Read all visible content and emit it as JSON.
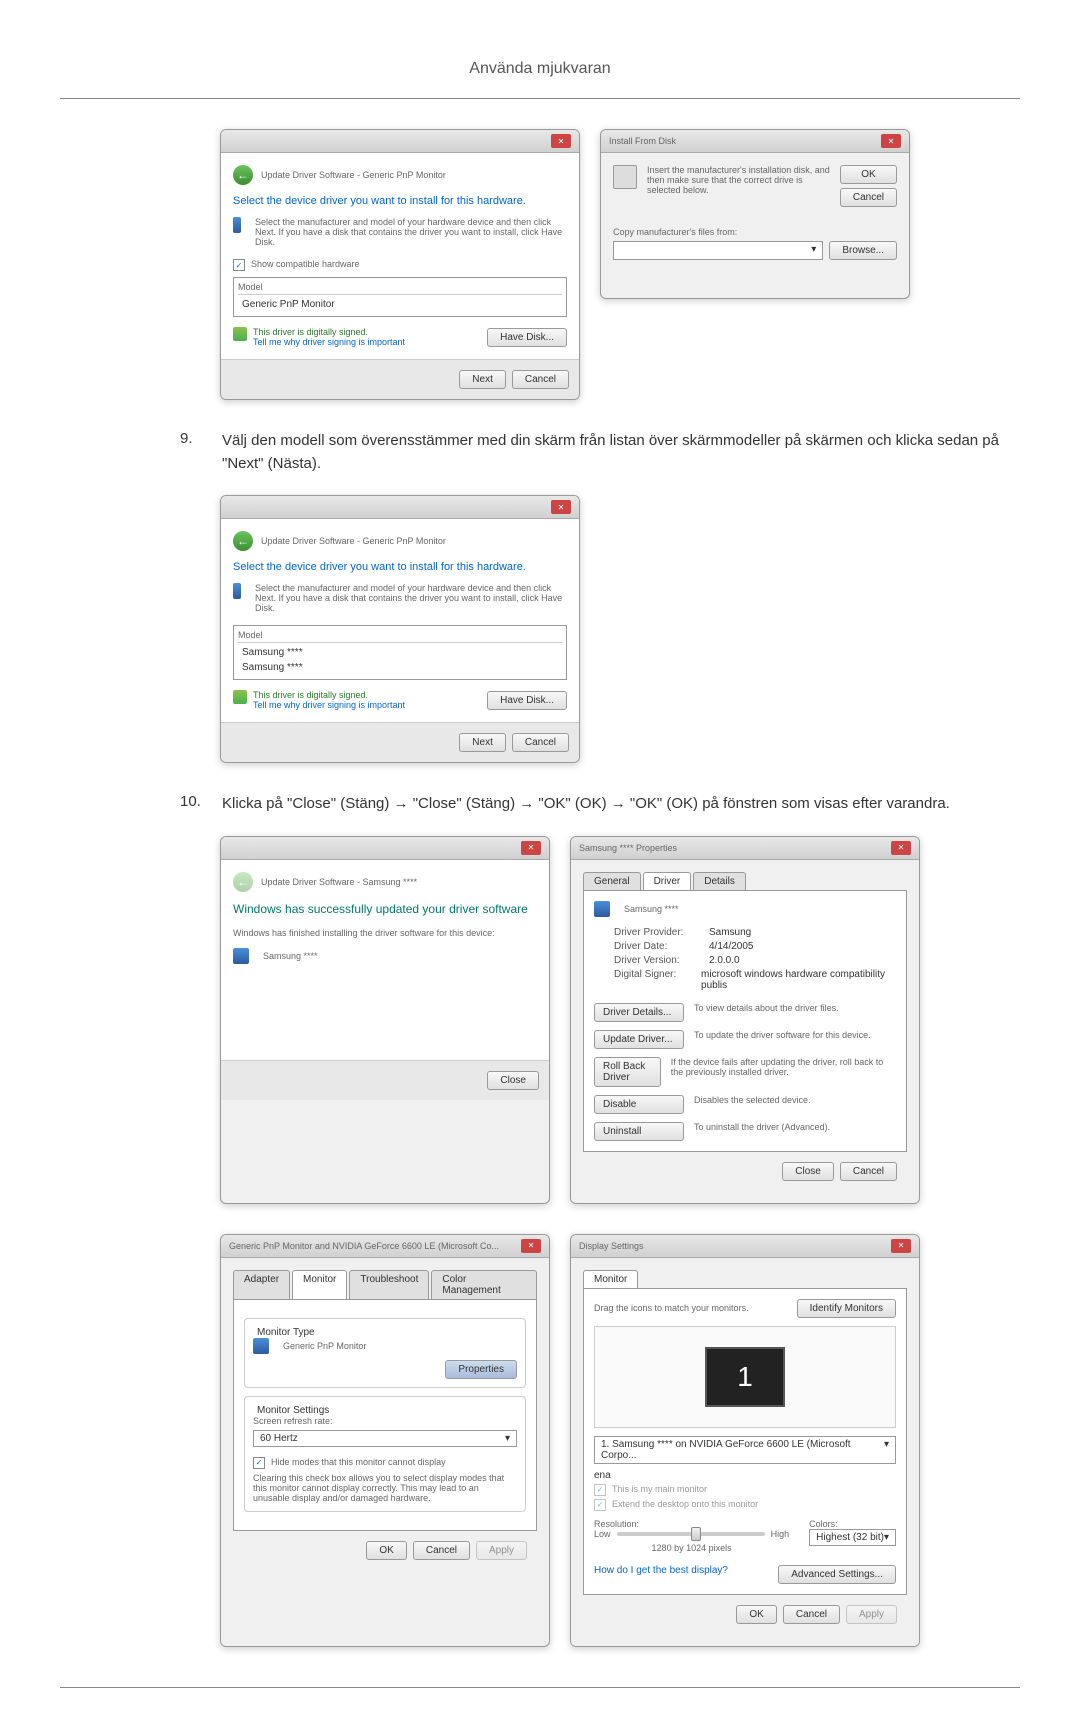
{
  "header": {
    "title": "Använda mjukvaran"
  },
  "windows": {
    "updateDriver1": {
      "breadcrumb": "Update Driver Software - Generic PnP Monitor",
      "heading": "Select the device driver you want to install for this hardware.",
      "description": "Select the manufacturer and model of your hardware device and then click Next. If you have a disk that contains the driver you want to install, click Have Disk.",
      "showCompatible": "Show compatible hardware",
      "modelLabel": "Model",
      "models": [
        "Generic PnP Monitor"
      ],
      "signedText": "This driver is digitally signed.",
      "signedLink": "Tell me why driver signing is important",
      "haveDisk": "Have Disk...",
      "next": "Next",
      "cancel": "Cancel"
    },
    "installFromDisk": {
      "title": "Install From Disk",
      "instruction": "Insert the manufacturer's installation disk, and then make sure that the correct drive is selected below.",
      "ok": "OK",
      "cancel": "Cancel",
      "copyFrom": "Copy manufacturer's files from:",
      "browse": "Browse..."
    },
    "updateDriver2": {
      "breadcrumb": "Update Driver Software - Generic PnP Monitor",
      "heading": "Select the device driver you want to install for this hardware.",
      "description": "Select the manufacturer and model of your hardware device and then click Next. If you have a disk that contains the driver you want to install, click Have Disk.",
      "modelLabel": "Model",
      "models": [
        "Samsung ****",
        "Samsung ****"
      ],
      "signedText": "This driver is digitally signed.",
      "signedLink": "Tell me why driver signing is important",
      "haveDisk": "Have Disk...",
      "next": "Next",
      "cancel": "Cancel"
    },
    "updateSuccess": {
      "breadcrumb": "Update Driver Software - Samsung ****",
      "heading": "Windows has successfully updated your driver software",
      "subtext": "Windows has finished installing the driver software for this device:",
      "deviceName": "Samsung ****",
      "close": "Close"
    },
    "properties": {
      "title": "Samsung **** Properties",
      "tabs": [
        "General",
        "Driver",
        "Details"
      ],
      "deviceName": "Samsung ****",
      "driverProvider": "Samsung",
      "driverDate": "4/14/2005",
      "driverVersion": "2.0.0.0",
      "digitalSigner": "microsoft windows hardware compatibility publis",
      "driverProviderLabel": "Driver Provider:",
      "driverDateLabel": "Driver Date:",
      "driverVersionLabel": "Driver Version:",
      "digitalSignerLabel": "Digital Signer:",
      "btnDetails": "Driver Details...",
      "btnDetailsDesc": "To view details about the driver files.",
      "btnUpdate": "Update Driver...",
      "btnUpdateDesc": "To update the driver software for this device.",
      "btnRollback": "Roll Back Driver",
      "btnRollbackDesc": "If the device fails after updating the driver, roll back to the previously installed driver.",
      "btnDisable": "Disable",
      "btnDisableDesc": "Disables the selected device.",
      "btnUninstall": "Uninstall",
      "btnUninstallDesc": "To uninstall the driver (Advanced).",
      "close": "Close",
      "cancel": "Cancel"
    },
    "monitorNvidia": {
      "title": "Generic PnP Monitor and NVIDIA GeForce 6600 LE (Microsoft Co...",
      "tabs": [
        "Adapter",
        "Monitor",
        "Troubleshoot",
        "Color Management"
      ],
      "monitorTypeLabel": "Monitor Type",
      "monitorType": "Generic PnP Monitor",
      "btnProperties": "Properties",
      "monitorSettingsLabel": "Monitor Settings",
      "refreshRateLabel": "Screen refresh rate:",
      "refreshRate": "60 Hertz",
      "hideModesCheck": "Hide modes that this monitor cannot display",
      "hideModesDesc": "Clearing this check box allows you to select display modes that this monitor cannot display correctly. This may lead to an unusable display and/or damaged hardware.",
      "ok": "OK",
      "cancel": "Cancel",
      "apply": "Apply"
    },
    "displaySettings": {
      "title": "Display Settings",
      "tab": "Monitor",
      "dragText": "Drag the icons to match your monitors.",
      "identifyBtn": "Identify Monitors",
      "monitorNum": "1",
      "monitorSelect": "1. Samsung **** on NVIDIA GeForce 6600 LE (Microsoft Corpo...",
      "mainMonitor": "This is my main monitor",
      "extendDesktop": "Extend the desktop onto this monitor",
      "resolutionLabel": "Resolution:",
      "low": "Low",
      "high": "High",
      "resolution": "1280 by 1024 pixels",
      "colorsLabel": "Colors:",
      "colorDepth": "Highest (32 bit)",
      "helpLink": "How do I get the best display?",
      "advancedBtn": "Advanced Settings...",
      "ok": "OK",
      "cancel": "Cancel",
      "apply": "Apply"
    }
  },
  "instructions": {
    "step9": {
      "num": "9.",
      "text": "Välj den modell som överensstämmer med din skärm från listan över skärmmodeller på skärmen och klicka sedan på \"Next\" (Nästa)."
    },
    "step10": {
      "num": "10.",
      "text": "Klicka på \"Close\" (Stäng) → \"Close\" (Stäng) → \"OK\" (OK) → \"OK\" (OK) på fönstren som visas efter varandra."
    }
  }
}
